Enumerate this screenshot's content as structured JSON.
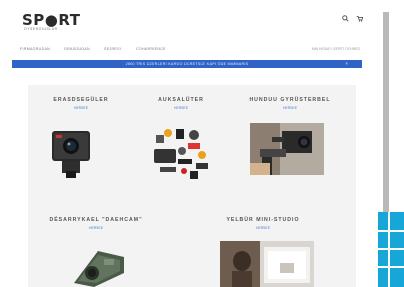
{
  "brand": {
    "logo": "SP●RT",
    "tagline": "GYSERGIUSLAR"
  },
  "header": {
    "search_icon": "search-icon",
    "cart_icon": "cart-icon"
  },
  "nav": {
    "items": [
      "FIRMAGRUDAN",
      "GRASGUDAN",
      "SEJRESI",
      "COHARRIENCE"
    ],
    "account": "MIN HESAP / SEPET OCHRED"
  },
  "banner": {
    "text": "2500 TRIS ÜZERLERI KARGO ÜCRETSIZ! KAPI ÖDE MIMMARIS",
    "close_label": "×"
  },
  "categories": [
    {
      "title": "ERASDSEGÜLER",
      "link": "HERSEE",
      "image": "action-camera"
    },
    {
      "title": "AUKSALÜTER",
      "link": "HERSEE",
      "image": "accessory-kit"
    },
    {
      "title": "HUNDUU GYRÜSTERBEL",
      "link": "HERSEE",
      "image": "gimbal-stabilizer"
    },
    {
      "title": "DÉSARRYKAEL \"DAEHCAM\"",
      "link": "HERSEE",
      "image": "dash-cam"
    },
    {
      "title": "YELBÜR MINI-STUDIO",
      "link": "HERSEE",
      "image": "mini-studio"
    }
  ],
  "colors": {
    "banner": "#2f63c5",
    "link": "#4c7ad0",
    "content_bg": "#f3f3f3"
  }
}
